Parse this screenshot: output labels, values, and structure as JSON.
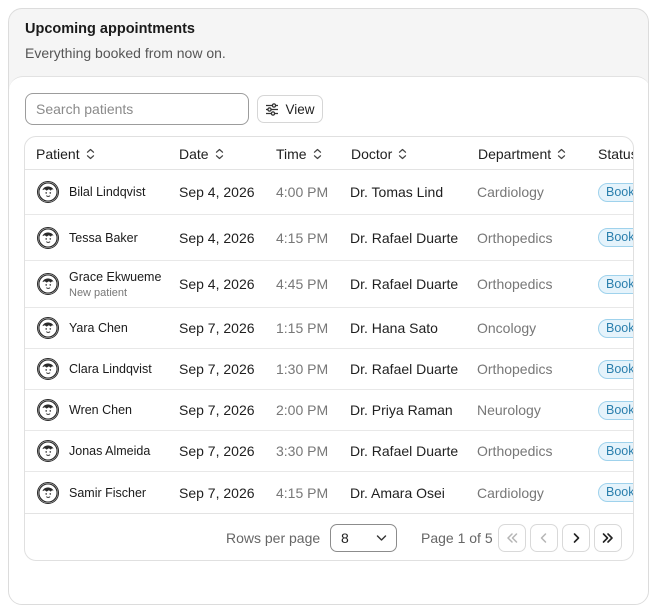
{
  "card": {
    "title": "Upcoming appointments",
    "subtitle": "Everything booked from now on."
  },
  "toolbar": {
    "search_placeholder": "Search patients",
    "view_label": "View"
  },
  "table": {
    "columns": [
      {
        "key": "patient",
        "label": "Patient"
      },
      {
        "key": "date",
        "label": "Date"
      },
      {
        "key": "time",
        "label": "Time"
      },
      {
        "key": "doctor",
        "label": "Doctor"
      },
      {
        "key": "department",
        "label": "Department"
      },
      {
        "key": "status",
        "label": "Status"
      }
    ],
    "rows": [
      {
        "patient": "Bilal Lindqvist",
        "sub": "",
        "date": "Sep 4, 2026",
        "time": "4:00 PM",
        "doctor": "Dr. Tomas Lind",
        "department": "Cardiology",
        "status": "Booked"
      },
      {
        "patient": "Tessa Baker",
        "sub": "",
        "date": "Sep 4, 2026",
        "time": "4:15 PM",
        "doctor": "Dr. Rafael Duarte",
        "department": "Orthopedics",
        "status": "Booked"
      },
      {
        "patient": "Grace Ekwueme",
        "sub": "New patient",
        "date": "Sep 4, 2026",
        "time": "4:45 PM",
        "doctor": "Dr. Rafael Duarte",
        "department": "Orthopedics",
        "status": "Booked"
      },
      {
        "patient": "Yara Chen",
        "sub": "",
        "date": "Sep 7, 2026",
        "time": "1:15 PM",
        "doctor": "Dr. Hana Sato",
        "department": "Oncology",
        "status": "Booked"
      },
      {
        "patient": "Clara Lindqvist",
        "sub": "",
        "date": "Sep 7, 2026",
        "time": "1:30 PM",
        "doctor": "Dr. Rafael Duarte",
        "department": "Orthopedics",
        "status": "Booked"
      },
      {
        "patient": "Wren Chen",
        "sub": "",
        "date": "Sep 7, 2026",
        "time": "2:00 PM",
        "doctor": "Dr. Priya Raman",
        "department": "Neurology",
        "status": "Booked"
      },
      {
        "patient": "Jonas Almeida",
        "sub": "",
        "date": "Sep 7, 2026",
        "time": "3:30 PM",
        "doctor": "Dr. Rafael Duarte",
        "department": "Orthopedics",
        "status": "Booked"
      },
      {
        "patient": "Samir Fischer",
        "sub": "",
        "date": "Sep 7, 2026",
        "time": "4:15 PM",
        "doctor": "Dr. Amara Osei",
        "department": "Cardiology",
        "status": "Booked"
      }
    ]
  },
  "pagination": {
    "rows_per_page_label": "Rows per page",
    "rows_per_page_value": "8",
    "page_label": "Page 1 of 5"
  },
  "colors": {
    "badge_text": "#2b7fad",
    "badge_bg": "#e5f3fb",
    "badge_border": "#9fd2ec"
  },
  "icons": [
    "sort-icon",
    "sliders-icon",
    "chevron-down-icon",
    "first-page-icon",
    "prev-page-icon",
    "next-page-icon",
    "last-page-icon",
    "avatar-icon"
  ]
}
